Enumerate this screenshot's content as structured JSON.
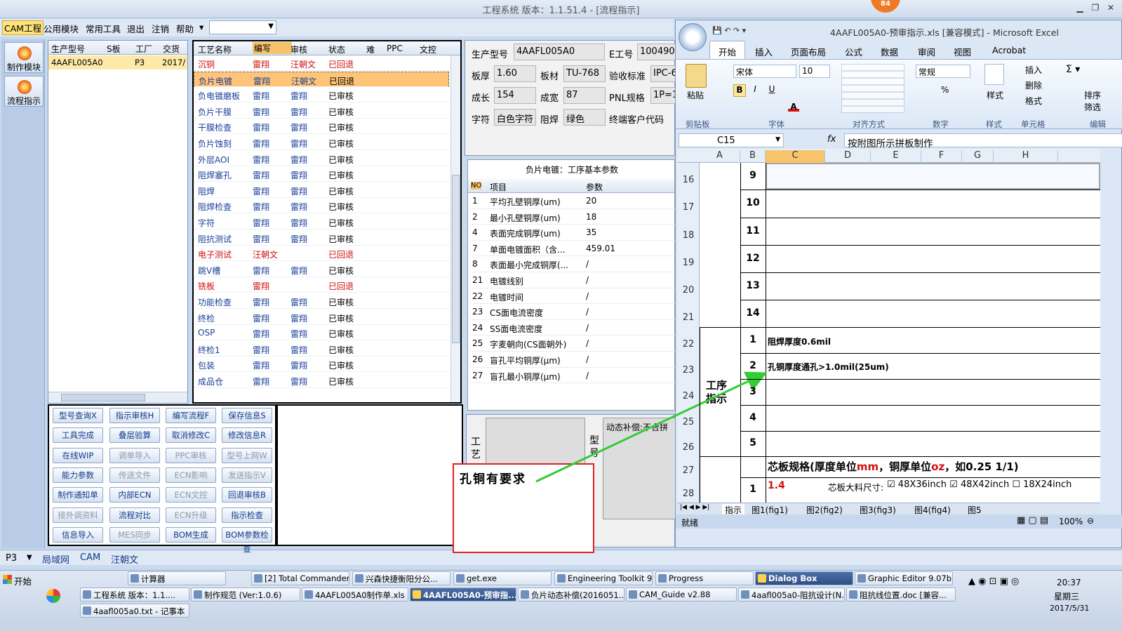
{
  "window": {
    "title": "工程系统   版本：1.1.51.4 - [流程指示]",
    "badge": "84"
  },
  "menu": {
    "items": [
      "CAM工程",
      "公用模块",
      "常用工具",
      "退出",
      "注销",
      "帮助"
    ],
    "dropdown_arrow": "▾"
  },
  "leftbar": {
    "buttons": [
      "制作模块",
      "流程指示"
    ]
  },
  "orders": {
    "headers": [
      "生产型号",
      "S板",
      "工厂",
      "交货日"
    ],
    "rows": [
      {
        "model": "4AAFL005A0",
        "factory": "P3",
        "date": "2017/"
      }
    ]
  },
  "process": {
    "headers": [
      "工艺名称",
      "编写",
      "审核",
      "状态",
      "难",
      "PPC",
      "文控"
    ],
    "rows": [
      {
        "name": "沉铜",
        "writer": "雷翔",
        "reviewer": "汪朝文",
        "status": "已回退",
        "red": true
      },
      {
        "name": "负片电镀",
        "writer": "雷翔",
        "reviewer": "汪朝文",
        "status": "已回退",
        "red": false,
        "selected": true
      },
      {
        "name": "负电镀磨板",
        "writer": "雷翔",
        "reviewer": "雷翔",
        "status": "已审核"
      },
      {
        "name": "负片干膜",
        "writer": "雷翔",
        "reviewer": "雷翔",
        "status": "已审核"
      },
      {
        "name": "干膜检查",
        "writer": "雷翔",
        "reviewer": "雷翔",
        "status": "已审核"
      },
      {
        "name": "负片蚀刻",
        "writer": "雷翔",
        "reviewer": "雷翔",
        "status": "已审核"
      },
      {
        "name": "外层AOI",
        "writer": "雷翔",
        "reviewer": "雷翔",
        "status": "已审核"
      },
      {
        "name": "阻焊塞孔",
        "writer": "雷翔",
        "reviewer": "雷翔",
        "status": "已审核"
      },
      {
        "name": "阻焊",
        "writer": "雷翔",
        "reviewer": "雷翔",
        "status": "已审核"
      },
      {
        "name": "阻焊检查",
        "writer": "雷翔",
        "reviewer": "雷翔",
        "status": "已审核"
      },
      {
        "name": "字符",
        "writer": "雷翔",
        "reviewer": "雷翔",
        "status": "已审核"
      },
      {
        "name": "阻抗测试",
        "writer": "雷翔",
        "reviewer": "雷翔",
        "status": "已审核"
      },
      {
        "name": "电子测试",
        "writer": "汪朝文",
        "reviewer": "",
        "status": "已回退",
        "red": true
      },
      {
        "name": "跳V槽",
        "writer": "雷翔",
        "reviewer": "雷翔",
        "status": "已审核"
      },
      {
        "name": "铣板",
        "writer": "雷翔",
        "reviewer": "",
        "status": "已回退",
        "red": true
      },
      {
        "name": "功能检查",
        "writer": "雷翔",
        "reviewer": "雷翔",
        "status": "已审核"
      },
      {
        "name": "终检",
        "writer": "雷翔",
        "reviewer": "雷翔",
        "status": "已审核"
      },
      {
        "name": "OSP",
        "writer": "雷翔",
        "reviewer": "雷翔",
        "status": "已审核"
      },
      {
        "name": "终检1",
        "writer": "雷翔",
        "reviewer": "雷翔",
        "status": "已审核"
      },
      {
        "name": "包装",
        "writer": "雷翔",
        "reviewer": "雷翔",
        "status": "已审核"
      },
      {
        "name": "成品仓",
        "writer": "雷翔",
        "reviewer": "雷翔",
        "status": "已审核"
      }
    ]
  },
  "info": {
    "labels": [
      "生产型号",
      "E工号",
      "板厚",
      "板材",
      "验收标准",
      "成长",
      "成宽",
      "PNL规格",
      "字符",
      "阻焊",
      "终端客户代码"
    ],
    "values": {
      "model": "4AAFL005A0",
      "eno": "100490",
      "thick": "1.60",
      "mat": "TU-768",
      "std": "IPC-6",
      "len": "154",
      "wid": "87",
      "pnl": "1P=1",
      "char": "白色字符",
      "mask": "绿色"
    }
  },
  "params": {
    "title": "负片电镀：工序基本参数",
    "headers": [
      "NO",
      "项目",
      "参数"
    ],
    "rows": [
      [
        "1",
        "平均孔壁铜厚(um)",
        "20"
      ],
      [
        "2",
        "最小孔壁铜厚(um)",
        "18"
      ],
      [
        "4",
        "表面完成铜厚(um)",
        "35"
      ],
      [
        "7",
        "单面电镀面积（含...",
        "459.01"
      ],
      [
        "8",
        "表面最小完成铜厚(...",
        "/"
      ],
      [
        "21",
        "电镀线别",
        "/"
      ],
      [
        "22",
        "电镀时间",
        "/"
      ],
      [
        "23",
        "CS面电流密度",
        "/"
      ],
      [
        "24",
        "SS面电流密度",
        "/"
      ],
      [
        "25",
        "字麦朝向(CS面朝外)",
        "/"
      ],
      [
        "26",
        "盲孔平均铜厚(μm)",
        "/"
      ],
      [
        "27",
        "盲孔最小铜厚(μm)",
        "/"
      ]
    ]
  },
  "notes": {
    "gy": "工艺",
    "xh": "型号",
    "text": "动态补偿:不合拼"
  },
  "buttons": [
    [
      "型号查询X",
      "指示审核H",
      "编写流程F",
      "保存信息S"
    ],
    [
      "工具完成",
      "叠层验算",
      "取消修改C",
      "修改信息R"
    ],
    [
      "在线WIP",
      "调单导入",
      "PPC审核",
      "型号上网W"
    ],
    [
      "能力参数",
      "传送文件",
      "ECN影响",
      "发送指示V"
    ],
    [
      "制作通知单",
      "内部ECN",
      "ECN文控",
      "回退审核B"
    ],
    [
      "接外调资料",
      "流程对比",
      "ECN升级",
      "指示检查"
    ],
    [
      "信息导入",
      "MES同步",
      "BOM生成",
      "BOM参数检查"
    ]
  ],
  "disabled": [
    "调单导入",
    "PPC审核",
    "型号上网W",
    "传送文件",
    "ECN影响",
    "发送指示V",
    "ECN文控",
    "接外调资料",
    "MES同步",
    "ECN升级"
  ],
  "callout": {
    "text": "孔铜有要求"
  },
  "status": {
    "items": [
      "P3",
      "局域网",
      "CAM",
      "汪朝文"
    ]
  },
  "excel": {
    "title": "4AAFL005A0-预审指示.xls [兼容模式] - Microsoft Excel",
    "tabs": [
      "开始",
      "插入",
      "页面布局",
      "公式",
      "数据",
      "审阅",
      "视图",
      "Acrobat"
    ],
    "groups": [
      "剪贴板",
      "字体",
      "对齐方式",
      "数字",
      "样式",
      "单元格",
      "编辑"
    ],
    "font": "宋体",
    "size": "10",
    "numfmt": "常规",
    "paste": "粘贴",
    "style": "样式",
    "ins": "插入",
    "del": "删除",
    "fmt": "格式",
    "sort": "排序",
    "filter": "筛选",
    "cellref": "C15",
    "formula": "按附图所示拼板制作",
    "cols": [
      "A",
      "B",
      "C",
      "D",
      "E",
      "F",
      "G",
      "H"
    ],
    "rownums": [
      "16",
      "17",
      "18",
      "19",
      "20",
      "21",
      "22",
      "23",
      "24",
      "25",
      "26",
      "27",
      "28"
    ],
    "gnums": [
      "9",
      "10",
      "11",
      "12",
      "13",
      "14",
      "1",
      "2",
      "3",
      "4",
      "5",
      "1"
    ],
    "c22": "阻焊厚度0.6mil",
    "c23": "孔铜厚度通孔>1.0mil(25um)",
    "section": "工序指示",
    "core": {
      "a": "芯板规格(厚度单位",
      "b": "mm",
      "c": "，铜厚单位",
      "d": "oz",
      "e": "，如0.25 1/1)"
    },
    "r28val": "1.4",
    "r28label": "芯板大料尺寸:",
    "r28opts": [
      "48X36inch",
      "48X42inch",
      "18X24inch"
    ],
    "sheets": [
      "指示",
      "图1(fig1)",
      "图2(fig2)",
      "图3(fig3)",
      "图4(fig4)",
      "图5"
    ],
    "status": "就绪",
    "zoom": "100%"
  },
  "taskbar": {
    "start": "开始",
    "row1": [
      "计算器",
      "[2] Total Commander ...",
      "兴森快捷衡阳分公...",
      "get.exe",
      "Engineering Toolkit 9....",
      "Progress",
      "Dialog Box",
      "Graphic Editor 9.07b2..."
    ],
    "row2": [
      "工程系统   版本：1.1....",
      "制作规范 (Ver:1.0.6)",
      "4AAFL005A0制作单.xls ...",
      "4AAFL005A0-预审指...",
      "负片动态补偿(2016051...",
      "CAM_Guide v2.88",
      "4aafl005a0-阻抗设计(N...",
      "阻抗线位置.doc [兼容..."
    ],
    "row3": [
      "4aafl005a0.txt - 记事本"
    ],
    "time": "20:37",
    "day": "星期三",
    "date": "2017/5/31"
  }
}
